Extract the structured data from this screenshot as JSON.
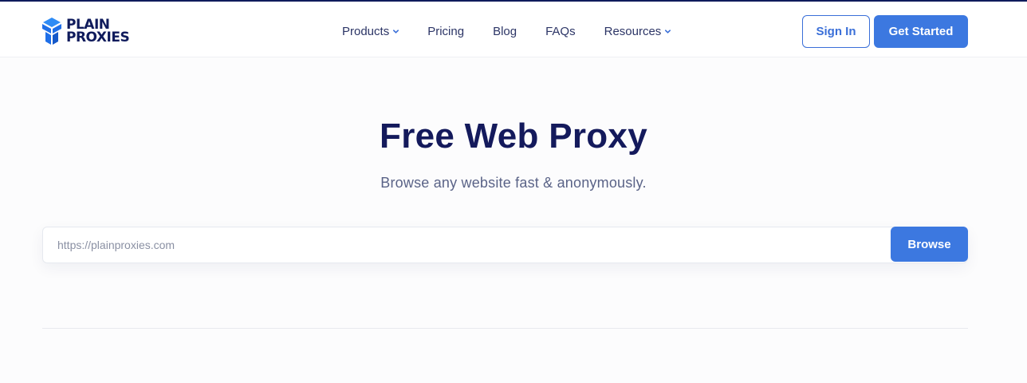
{
  "header": {
    "logo": {
      "line1": "PLAIN",
      "line2": "PROXIES",
      "icon": "plain-proxies-logo-icon",
      "brand_color": "#1f6fe8"
    },
    "nav": [
      {
        "label": "Products",
        "has_dropdown": true
      },
      {
        "label": "Pricing",
        "has_dropdown": false
      },
      {
        "label": "Blog",
        "has_dropdown": false
      },
      {
        "label": "FAQs",
        "has_dropdown": false
      },
      {
        "label": "Resources",
        "has_dropdown": true
      }
    ],
    "sign_in_label": "Sign In",
    "get_started_label": "Get Started"
  },
  "hero": {
    "title": "Free Web Proxy",
    "subtitle": "Browse any website fast & anonymously."
  },
  "search": {
    "placeholder": "https://plainproxies.com",
    "value": "",
    "button_label": "Browse"
  },
  "colors": {
    "accent": "#3c78e0",
    "navy": "#141a5c",
    "background": "#fcfcfd"
  }
}
